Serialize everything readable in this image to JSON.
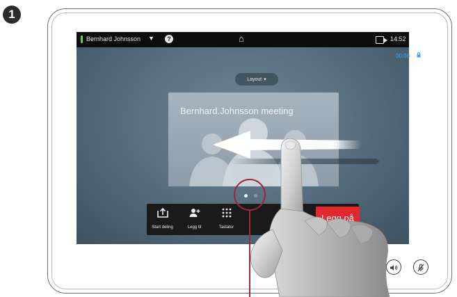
{
  "step": {
    "number": "1"
  },
  "status_bar": {
    "caller": "Bernhard Johnsson",
    "dropdown_glyph": "▼",
    "help_glyph": "?",
    "home_glyph": "⌂",
    "time": "14:52"
  },
  "call": {
    "duration": "00:08",
    "lock_glyph": "🔒"
  },
  "layout": {
    "label": "Layout",
    "caret": "▾"
  },
  "meeting": {
    "title": "Bernhard.Johnsson meeting"
  },
  "pager": {
    "active_page": 1,
    "page_count": 2
  },
  "toolbar": {
    "share_label": "Start deling",
    "add_label": "Legg til",
    "keypad_label": "Tastatur",
    "hangup_label": "Legg på"
  },
  "hardware": {
    "volume_icon": "volume-icon",
    "mute_icon": "microphone-mute-icon"
  },
  "colors": {
    "accent_blue": "#3aa6ff",
    "hangup_red": "#e0282e",
    "callout": "#a0263b",
    "presence_green": "#5bd34b"
  }
}
